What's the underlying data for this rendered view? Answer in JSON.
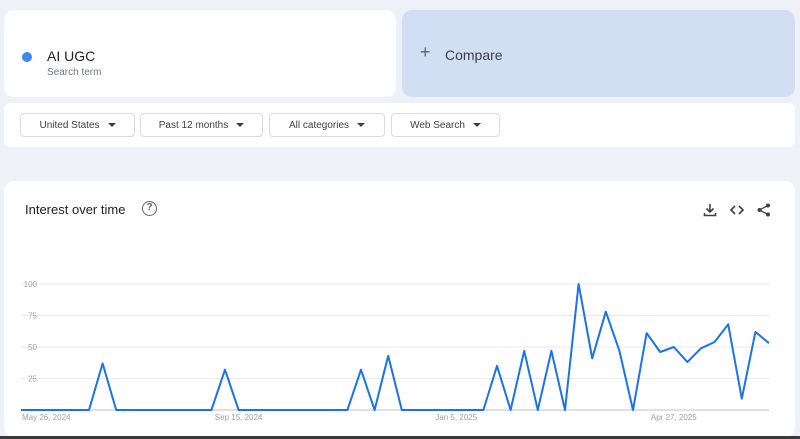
{
  "search_term": {
    "name": "AI UGC",
    "subtitle": "Search term",
    "color": "#4285f4"
  },
  "compare": {
    "label": "Compare"
  },
  "filters": [
    {
      "label": "United States"
    },
    {
      "label": "Past 12 months"
    },
    {
      "label": "All categories"
    },
    {
      "label": "Web Search"
    }
  ],
  "chart": {
    "title": "Interest over time",
    "tools": [
      "download-icon",
      "embed-code-icon",
      "share-icon"
    ]
  },
  "chart_data": {
    "type": "line",
    "title": "Interest over time",
    "xlabel": "",
    "ylabel": "",
    "ylim": [
      0,
      100
    ],
    "yticks": [
      0,
      25,
      50,
      75,
      100
    ],
    "ytick_labels": [
      "",
      "25",
      "50",
      "75",
      "100"
    ],
    "xtick_labels": [
      "May 26, 2024",
      "Sep 15, 2024",
      "Jan 5, 2025",
      "Apr 27, 2025"
    ],
    "xtick_index": [
      0,
      16,
      32,
      48
    ],
    "grid": true,
    "series": [
      {
        "color": "#1a73e8",
        "values": [
          0,
          0,
          0,
          0,
          0,
          0,
          37,
          0,
          0,
          0,
          0,
          0,
          0,
          0,
          0,
          32,
          0,
          0,
          0,
          0,
          0,
          0,
          0,
          0,
          0,
          32,
          0,
          43,
          0,
          0,
          0,
          0,
          0,
          0,
          0,
          35,
          0,
          47,
          0,
          47,
          0,
          100,
          41,
          78,
          47,
          0,
          61,
          46,
          50,
          38,
          49,
          54,
          68,
          9,
          62,
          53
        ]
      }
    ]
  }
}
